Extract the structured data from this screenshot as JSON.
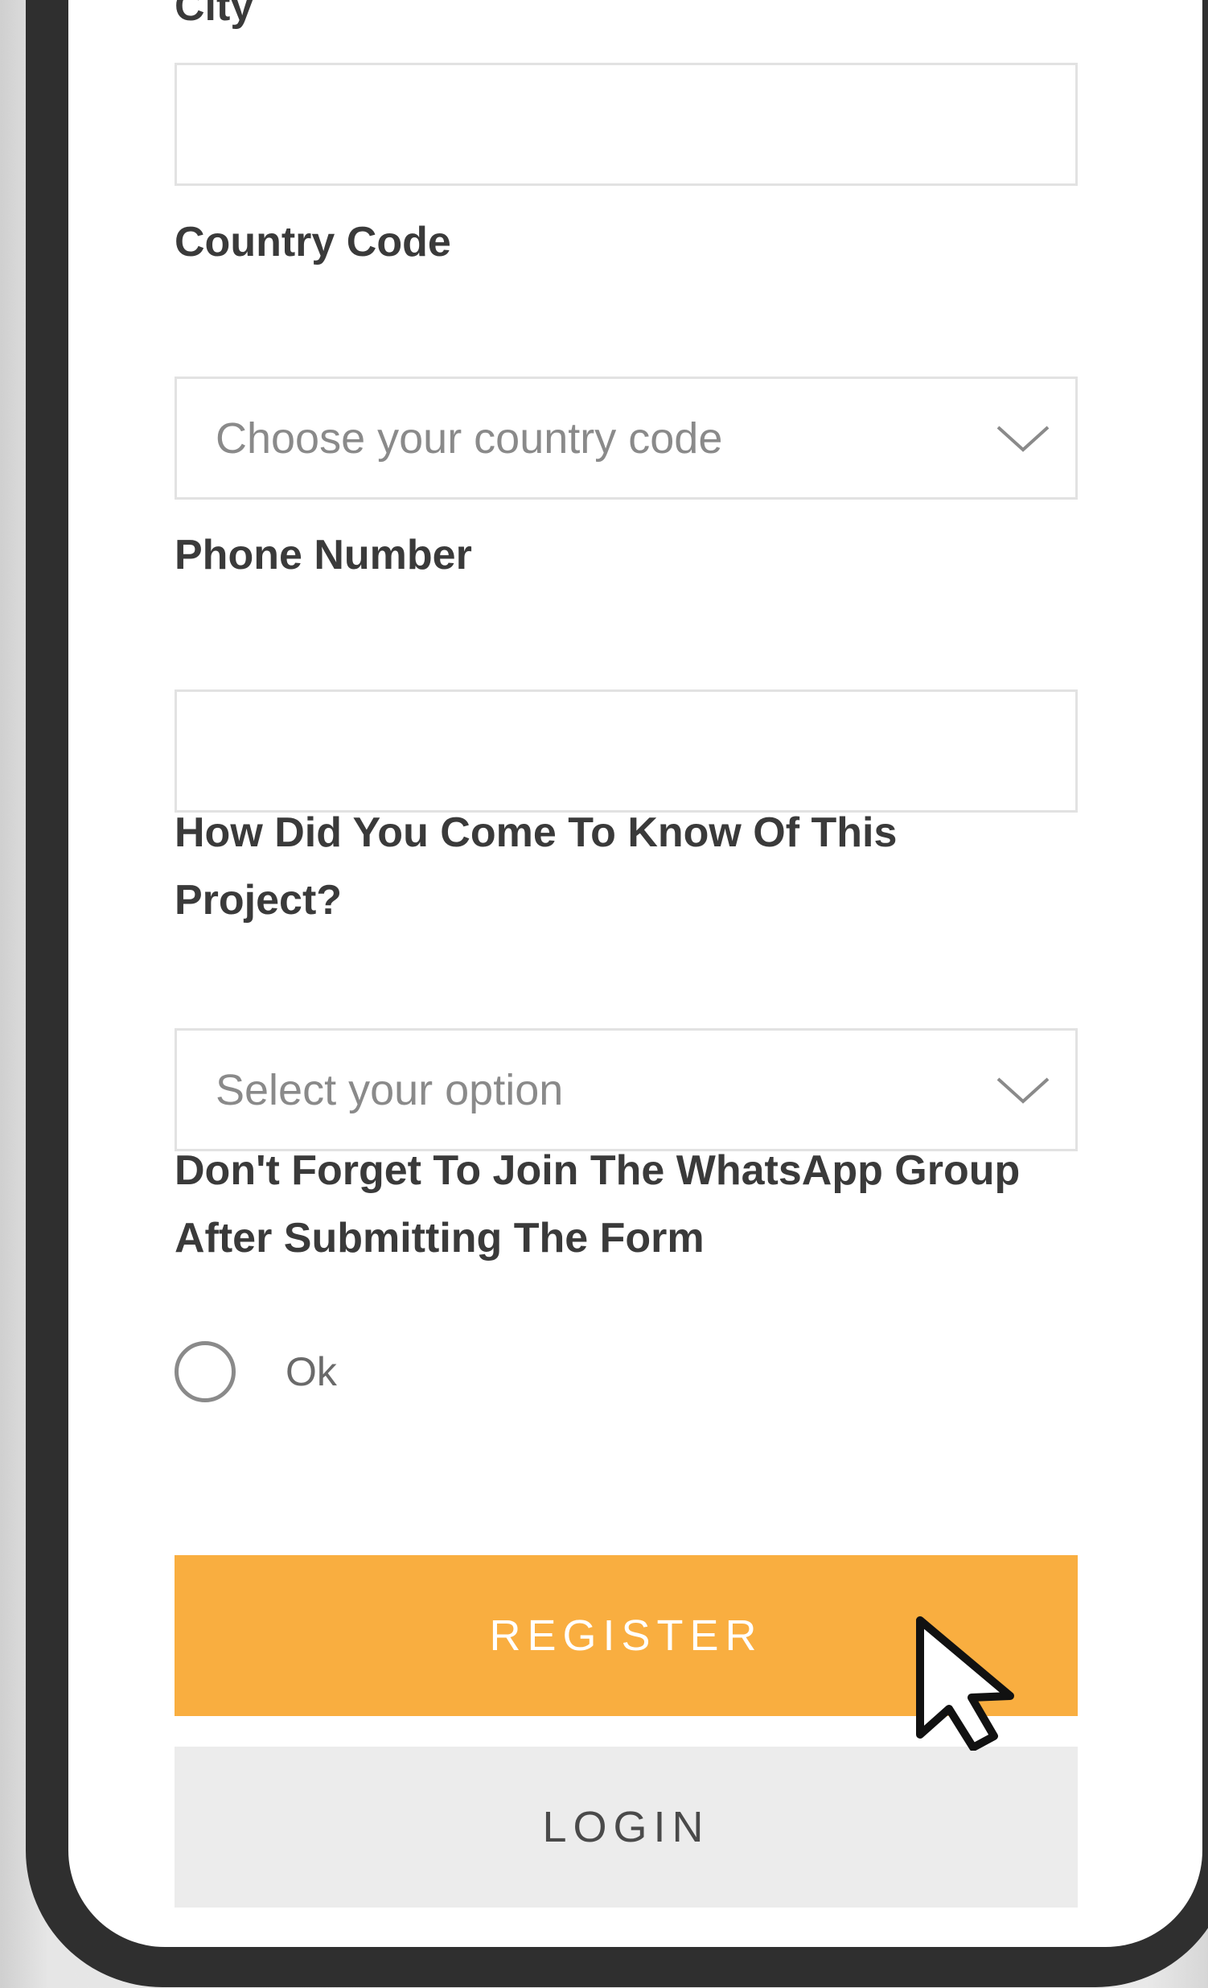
{
  "form": {
    "city": {
      "label": "City",
      "value": ""
    },
    "country_code": {
      "label": "Country Code",
      "placeholder": "Choose your country code"
    },
    "phone": {
      "label": "Phone Number",
      "value": ""
    },
    "source": {
      "label": "How Did You Come To Know Of This Project?",
      "placeholder": "Select your option"
    },
    "whatsapp": {
      "label": "Don't Forget To Join The WhatsApp Group After Submitting The Form",
      "option": "Ok",
      "selected": false
    }
  },
  "buttons": {
    "register": "REGISTER",
    "login": "LOGIN"
  },
  "colors": {
    "accent": "#f9ae40",
    "frame": "#2f2f2f",
    "login_bg": "#ececec"
  },
  "icons": {
    "dropdown": "chevron-down-icon",
    "pointer": "mouse-cursor-icon"
  }
}
